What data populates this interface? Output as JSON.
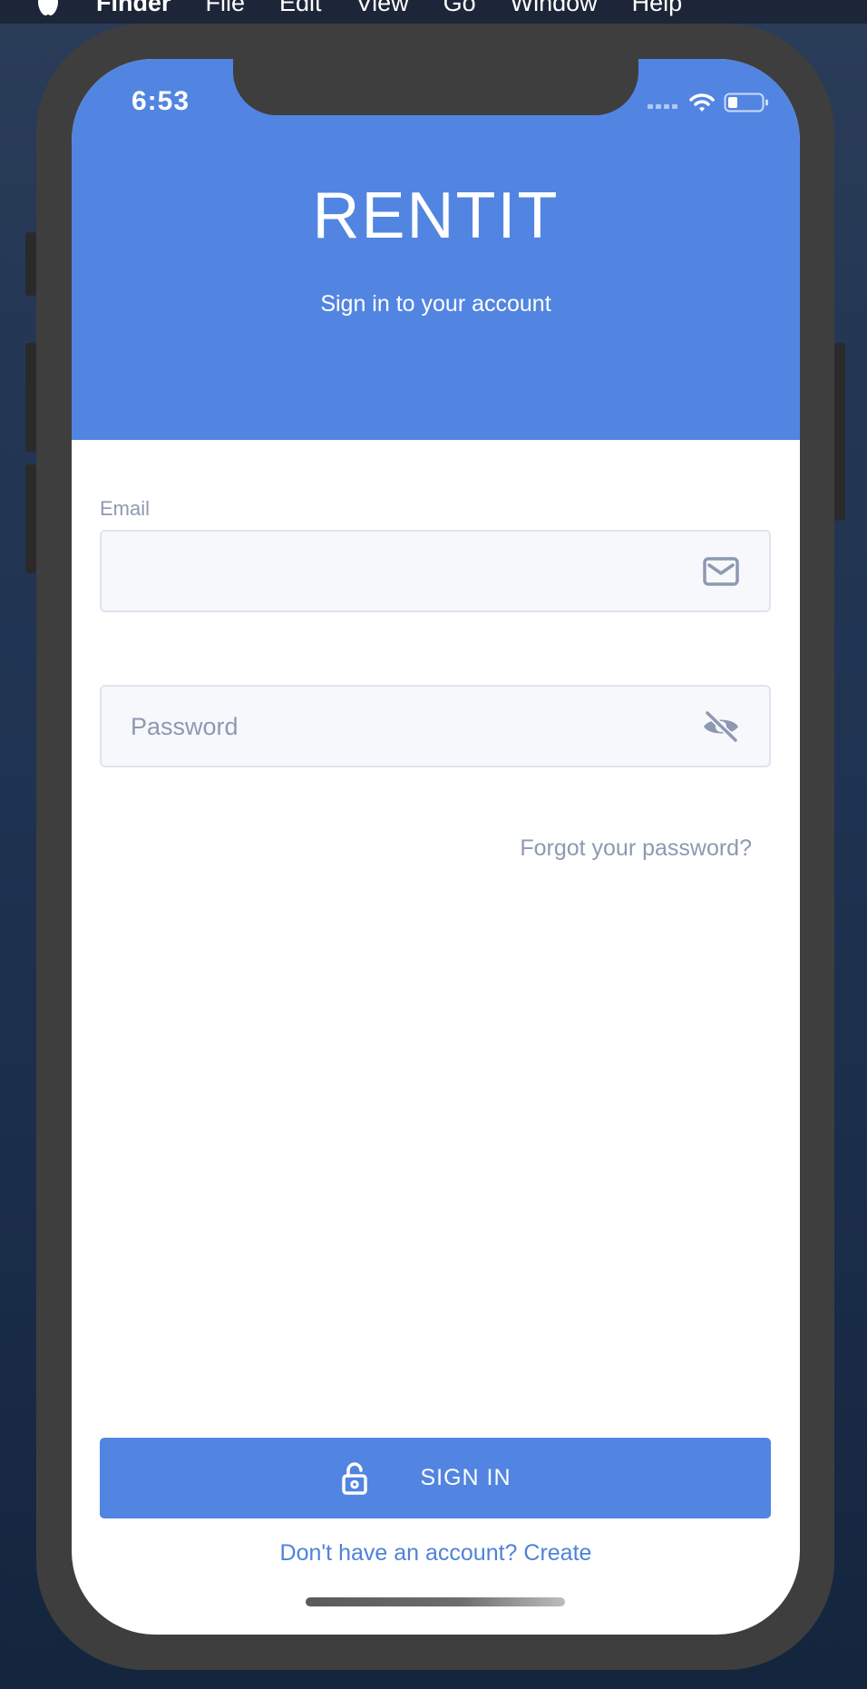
{
  "menubar": {
    "app_name": "Finder",
    "items": [
      "File",
      "Edit",
      "View",
      "Go",
      "Window",
      "Help"
    ]
  },
  "status_bar": {
    "time": "6:53",
    "icons": [
      "cellular-signal-icon",
      "wifi-icon",
      "battery-icon"
    ]
  },
  "header": {
    "title": "RENTIT",
    "subtitle": "Sign in to your account"
  },
  "form": {
    "email": {
      "label": "Email",
      "value": "",
      "placeholder": "",
      "icon": "mail-icon"
    },
    "password": {
      "value": "",
      "placeholder": "Password",
      "icon": "eye-off-icon"
    },
    "forgot_link": "Forgot your password?",
    "sign_in_button": {
      "label": "SIGN IN",
      "icon": "unlock-icon"
    },
    "create_account_link": "Don't have an account? Create"
  },
  "colors": {
    "primary": "#5285e1",
    "muted_text": "#8e99b0",
    "field_background": "#f7f8fc",
    "field_border": "#e1e4ee"
  }
}
